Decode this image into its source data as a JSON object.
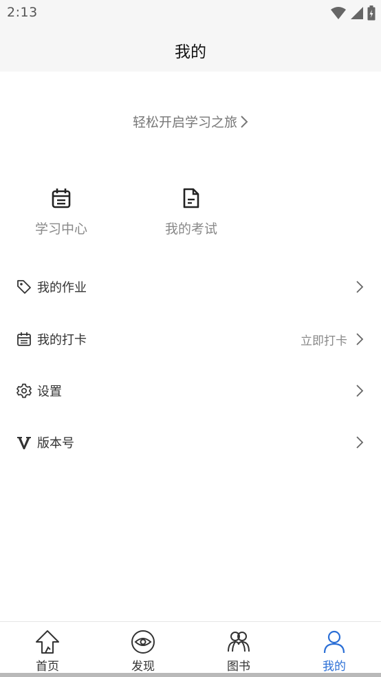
{
  "status_bar": {
    "time": "2:13",
    "icons": [
      "wifi-icon",
      "signal-icon",
      "battery-icon"
    ]
  },
  "header": {
    "title": "我的"
  },
  "banner": {
    "text": "轻松开启学习之旅"
  },
  "shortcuts": [
    {
      "label": "学习中心",
      "icon": "calendar-icon"
    },
    {
      "label": "我的考试",
      "icon": "document-icon"
    }
  ],
  "menu": [
    {
      "label": "我的作业",
      "value": "",
      "icon": "tag-icon"
    },
    {
      "label": "我的打卡",
      "value": "立即打卡",
      "icon": "calendar-icon"
    },
    {
      "label": "设置",
      "value": "",
      "icon": "gear-icon"
    },
    {
      "label": "版本号",
      "value": "",
      "icon": "version-v-icon"
    }
  ],
  "tabs": [
    {
      "label": "首页",
      "icon": "home-icon",
      "active": false
    },
    {
      "label": "发现",
      "icon": "eye-icon",
      "active": false
    },
    {
      "label": "图书",
      "icon": "group-icon",
      "active": false
    },
    {
      "label": "我的",
      "icon": "user-icon",
      "active": true
    }
  ],
  "colors": {
    "active_tab": "#2b6fd6",
    "title_bar_bg": "#f6f6f6",
    "secondary_text": "#888888"
  }
}
